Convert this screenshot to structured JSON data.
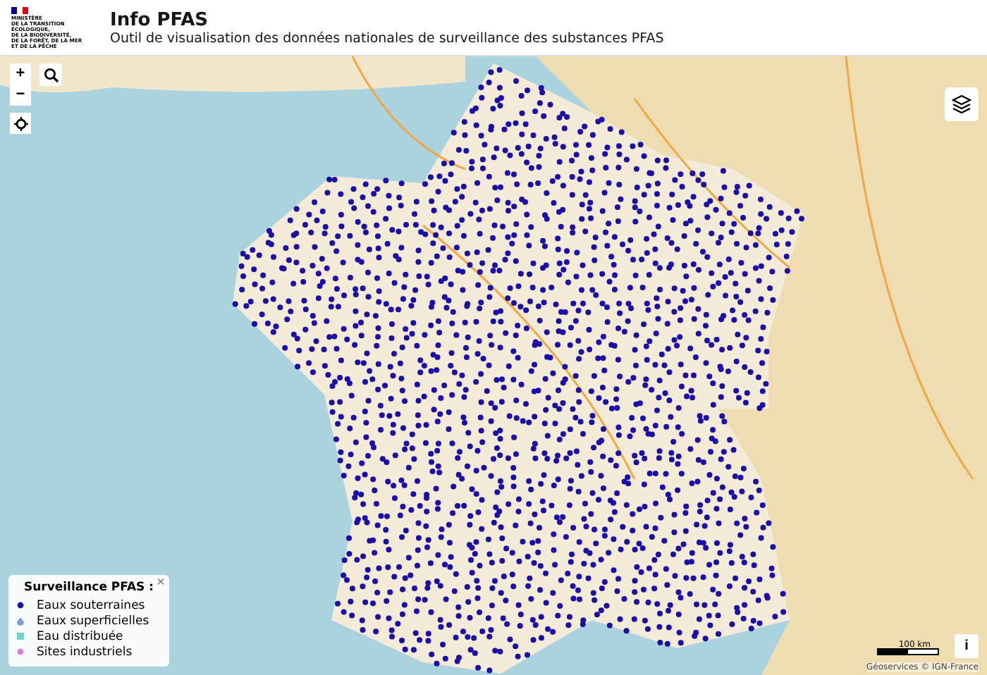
{
  "header": {
    "logo_lines": [
      "MINISTÈRE",
      "DE LA TRANSITION",
      "ÉCOLOGIQUE,",
      "DE LA BIODIVERSITÉ,",
      "DE LA FORÊT, DE LA MER",
      "ET DE LA PÊCHE"
    ],
    "title": "Info PFAS",
    "subtitle": "Outil de visualisation des données nationales de surveillance des substances PFAS"
  },
  "map_controls": {
    "zoom_in": "+",
    "zoom_out": "−"
  },
  "legend": {
    "title": "Surveillance PFAS :",
    "close": "×",
    "items": [
      {
        "label": "Eaux souterraines",
        "color": "#1a0dab",
        "kind": "dot"
      },
      {
        "label": "Eaux superficielles",
        "color": "#7a9be0",
        "kind": "drop"
      },
      {
        "label": "Eau distribuée",
        "color": "#6fd3cf",
        "kind": "square"
      },
      {
        "label": "Sites industriels",
        "color": "#d77fd4",
        "kind": "dot"
      }
    ]
  },
  "scale": {
    "label": "100 km"
  },
  "attribution": "Géoservices © IGN-France",
  "info_button": "i"
}
